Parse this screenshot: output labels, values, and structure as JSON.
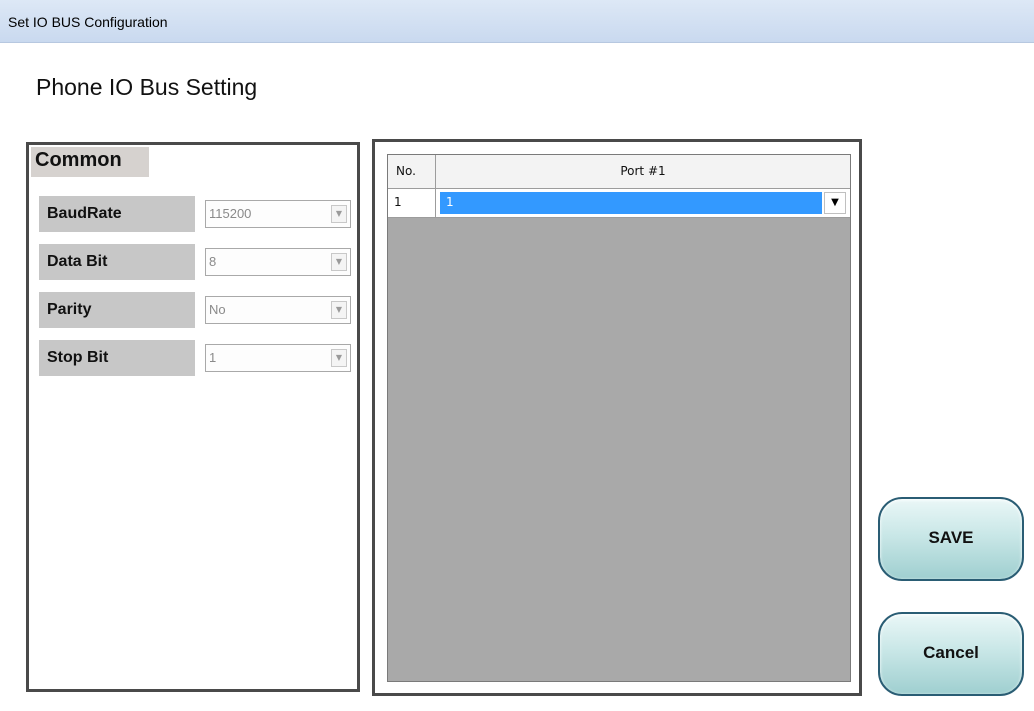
{
  "window": {
    "title": "Set IO BUS Configuration"
  },
  "page": {
    "title": "Phone IO Bus Setting"
  },
  "common": {
    "header": "Common",
    "fields": [
      {
        "label": "BaudRate",
        "value": "115200"
      },
      {
        "label": "Data Bit",
        "value": "8"
      },
      {
        "label": "Parity",
        "value": "No"
      },
      {
        "label": "Stop Bit",
        "value": "1"
      }
    ]
  },
  "grid": {
    "columns": [
      "No.",
      "Port #1"
    ],
    "rows": [
      {
        "no": "1",
        "port": "1"
      }
    ]
  },
  "buttons": {
    "save": "SAVE",
    "cancel": "Cancel"
  },
  "colors": {
    "selection": "#3399ff",
    "button_border": "#2a5d74",
    "grid_background": "#a9a9a9"
  },
  "icons": {
    "combo_arrow": "chevron-down-icon",
    "cell_dropdown": "dropdown-arrow-icon"
  }
}
